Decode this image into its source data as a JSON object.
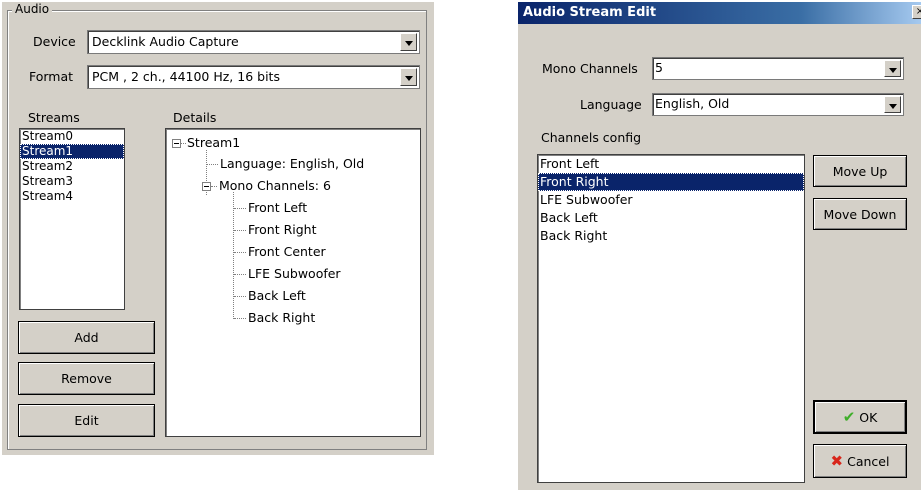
{
  "audio_panel": {
    "group_title": "Audio",
    "device_label": "Device",
    "device_value": "Decklink Audio Capture",
    "format_label": "Format",
    "format_value": "PCM , 2 ch., 44100 Hz, 16 bits",
    "streams_label": "Streams",
    "details_label": "Details",
    "streams": [
      "Stream0",
      "Stream1",
      "Stream2",
      "Stream3",
      "Stream4"
    ],
    "selected_stream": "Stream1",
    "buttons": {
      "add": "Add",
      "remove": "Remove",
      "edit": "Edit"
    },
    "details_tree": {
      "root": "Stream1",
      "language": "Language: English, Old",
      "mono_channels": "Mono Channels: 6",
      "channels": [
        "Front Left",
        "Front Right",
        "Front Center",
        "LFE Subwoofer",
        "Back Left",
        "Back Right"
      ]
    }
  },
  "dialog": {
    "title": "Audio Stream Edit",
    "close_glyph": "×",
    "mono_channels_label": "Mono Channels",
    "mono_channels_value": "5",
    "language_label": "Language",
    "language_value": "English, Old",
    "channels_config_label": "Channels config",
    "channels": [
      "Front Left",
      "Front Right",
      "LFE Subwoofer",
      "Back Left",
      "Back Right"
    ],
    "selected_channel": "Front Right",
    "buttons": {
      "move_up": "Move Up",
      "move_down": "Move Down",
      "ok": "OK",
      "cancel": "Cancel"
    },
    "icons": {
      "ok": "check-icon",
      "cancel": "cross-icon"
    }
  }
}
